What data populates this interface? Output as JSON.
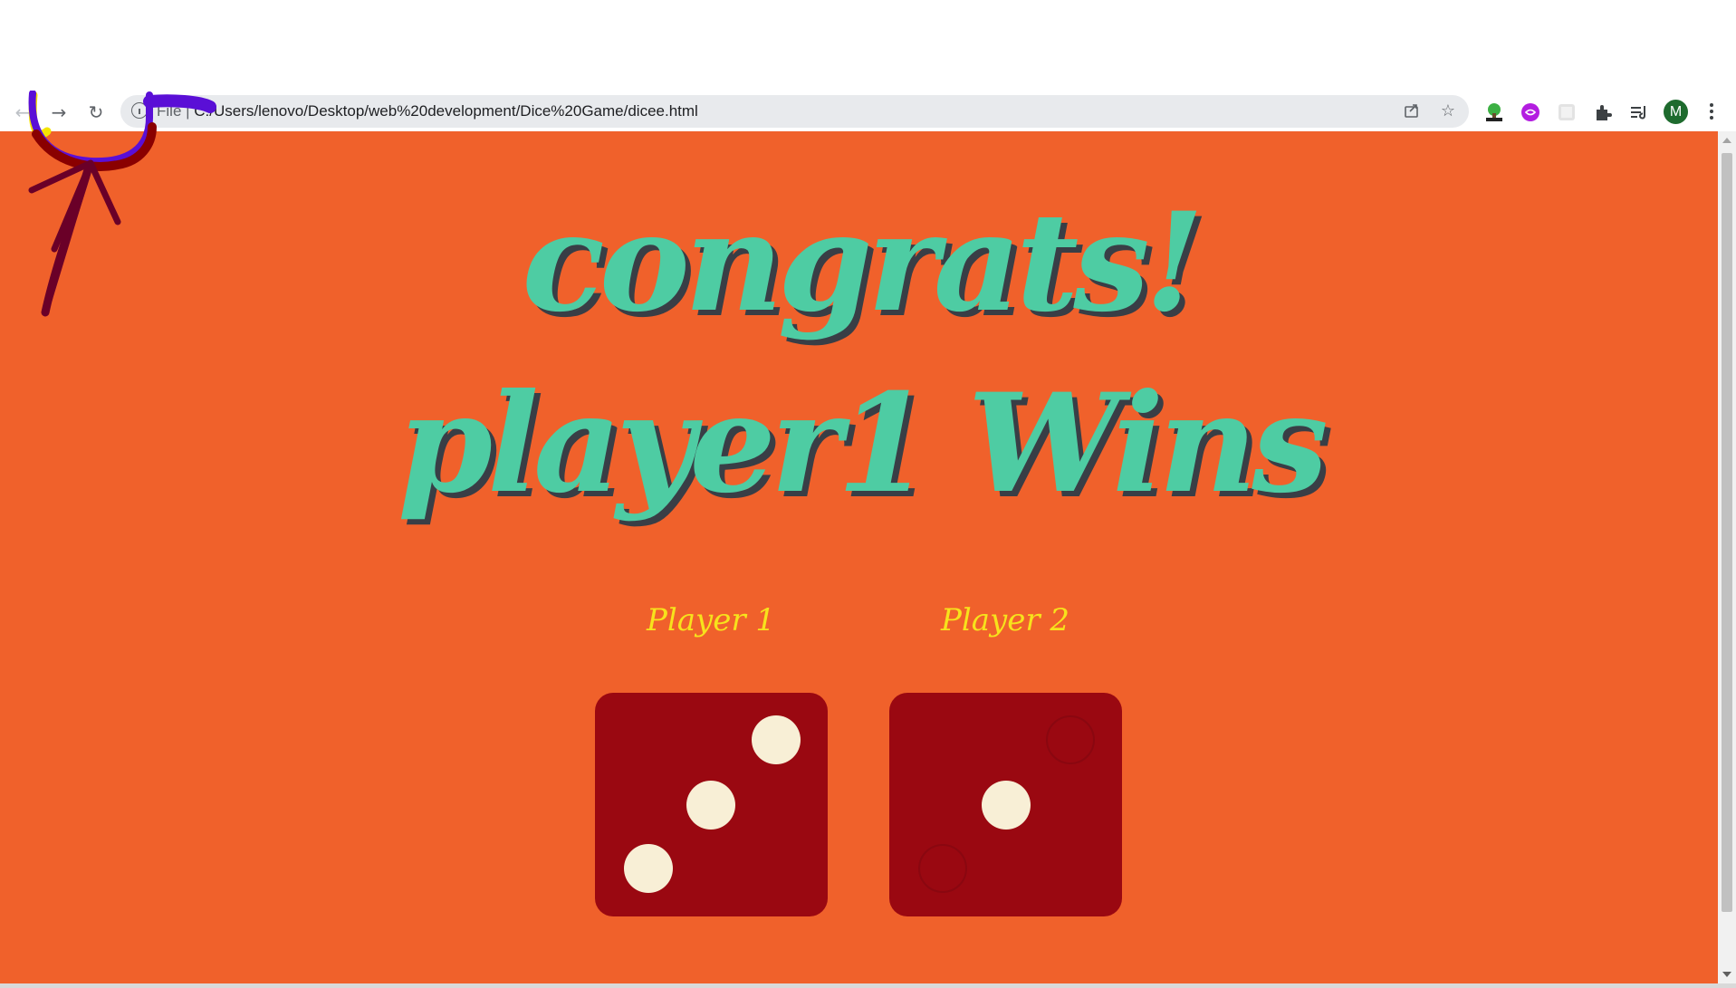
{
  "browser": {
    "url_prefix": "File | ",
    "url_rest": "C:/Users/lenovo/Desktop/web%20development/Dice%20Game/dicee.html",
    "profile_initial": "M",
    "back_icon": "arrow-left",
    "forward_icon": "arrow-right",
    "reload_icon": "reload",
    "share_icon": "share",
    "bookmark_icon": "star",
    "extensions": [
      "html-tree-extension",
      "purple-extension",
      "grey-extension",
      "puzzle-extensions",
      "reading-list"
    ]
  },
  "game": {
    "headline": "congrats! player1 Wins",
    "player1_label": "Player 1",
    "player2_label": "Player 2",
    "player1_die": 3,
    "player2_die": 1
  },
  "colors": {
    "background": "#f0612b",
    "headline": "#4ecca3",
    "headline_shadow": "#393e46",
    "player_label": "#f7e21c",
    "die": "#9a0811",
    "pip": "#f8efd6"
  }
}
